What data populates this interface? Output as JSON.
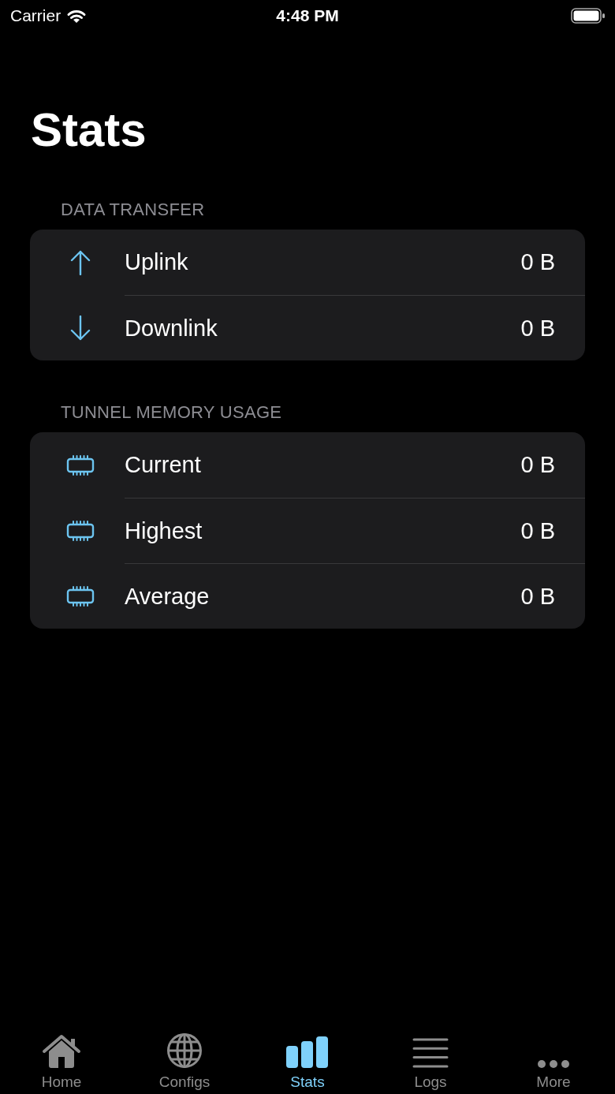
{
  "status_bar": {
    "carrier": "Carrier",
    "time": "4:48 PM"
  },
  "title": "Stats",
  "sections": [
    {
      "header": "DATA TRANSFER",
      "rows": [
        {
          "kind": "up",
          "label": "Uplink",
          "value": "0 B"
        },
        {
          "kind": "down",
          "label": "Downlink",
          "value": "0 B"
        }
      ]
    },
    {
      "header": "TUNNEL MEMORY USAGE",
      "rows": [
        {
          "kind": "chip",
          "label": "Current",
          "value": "0 B"
        },
        {
          "kind": "chip",
          "label": "Highest",
          "value": "0 B"
        },
        {
          "kind": "chip",
          "label": "Average",
          "value": "0 B"
        }
      ]
    }
  ],
  "tabs": [
    {
      "kind": "home",
      "label": "Home",
      "selected": false
    },
    {
      "kind": "globe",
      "label": "Configs",
      "selected": false
    },
    {
      "kind": "bars",
      "label": "Stats",
      "selected": true
    },
    {
      "kind": "lines",
      "label": "Logs",
      "selected": false
    },
    {
      "kind": "dots",
      "label": "More",
      "selected": false
    }
  ]
}
